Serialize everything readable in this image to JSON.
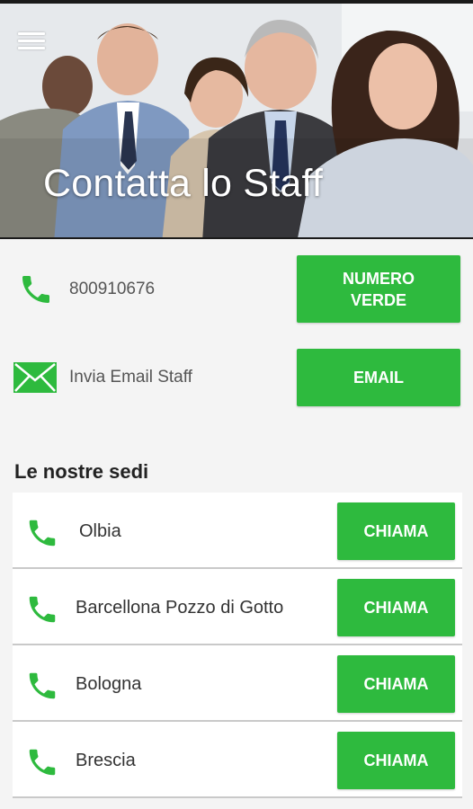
{
  "header": {
    "title": "Contatta lo Staff"
  },
  "contacts": {
    "phone": {
      "number": "800910676",
      "button_label": "NUMERO\nVERDE",
      "icon": "phone-icon"
    },
    "email": {
      "label": "Invia Email Staff",
      "button_label": "EMAIL",
      "icon": "envelope-icon"
    }
  },
  "sedi": {
    "title": "Le nostre sedi",
    "items": [
      {
        "name": "Olbia",
        "button_label": "CHIAMA"
      },
      {
        "name": "Barcellona Pozzo di Gotto",
        "button_label": "CHIAMA"
      },
      {
        "name": "Bologna",
        "button_label": "CHIAMA"
      },
      {
        "name": "Brescia",
        "button_label": "CHIAMA"
      }
    ]
  },
  "colors": {
    "accent_green": "#2eba3e",
    "icon_green": "#2eba3e",
    "background": "#f4f4f4"
  }
}
